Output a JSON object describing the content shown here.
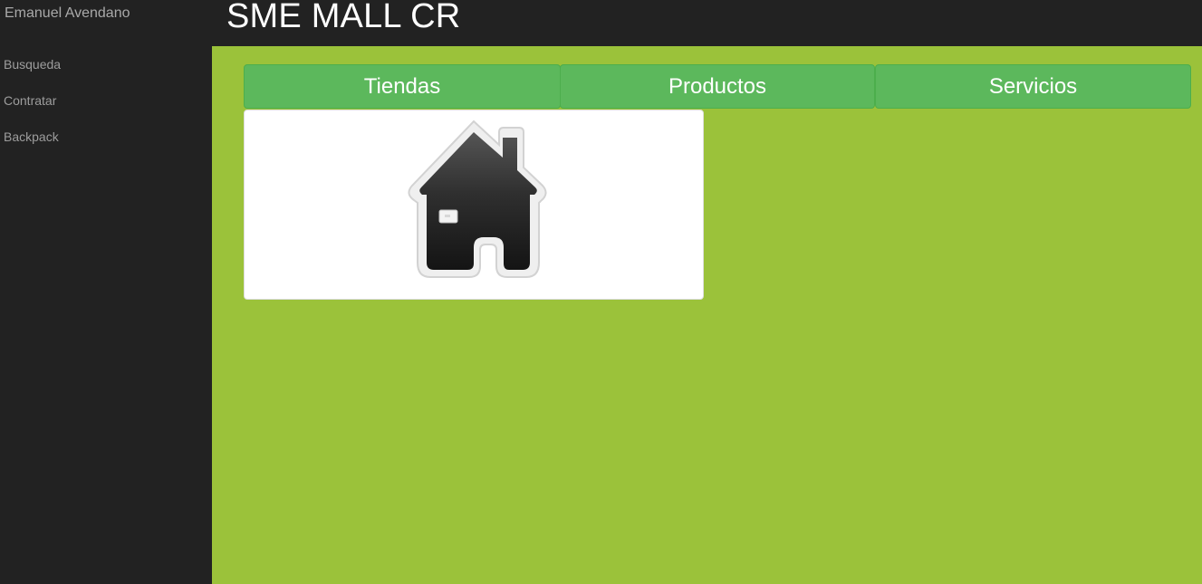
{
  "sidebar": {
    "brand": "Emanuel Avendano",
    "items": [
      {
        "label": "Busqueda"
      },
      {
        "label": "Contratar"
      },
      {
        "label": "Backpack"
      }
    ]
  },
  "header": {
    "title": "SME MALL CR"
  },
  "tabs": [
    {
      "label": "Tiendas"
    },
    {
      "label": "Productos"
    },
    {
      "label": "Servicios"
    }
  ],
  "content": {
    "card_icon": "home-icon"
  },
  "colors": {
    "sidebar_bg": "#222222",
    "main_bg": "#9bc23a",
    "tab_bg": "#5cb85c",
    "card_bg": "#ffffff"
  }
}
